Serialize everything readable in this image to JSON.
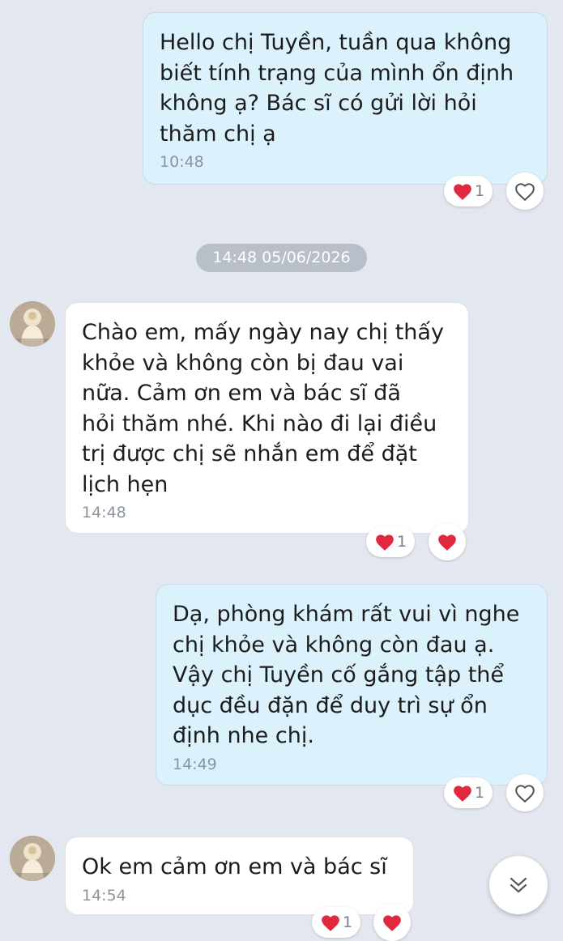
{
  "conversation": {
    "date_separator": "14:48 05/06/2026",
    "messages": [
      {
        "sender": "self",
        "text": "Hello chị Tuyền, tuần qua không\nbiết tính trạng của mình ổn định\nkhông ạ? Bác sĩ có gửi lời hỏi\nthăm chị ạ",
        "time": "10:48",
        "reaction": {
          "icon": "heart",
          "count": "1",
          "liked_by_me": false
        }
      },
      {
        "sender": "contact",
        "text": "Chào em, mấy ngày nay chị thấy\nkhỏe và không còn bị đau vai\nnữa. Cảm ơn em và bác sĩ đã\nhỏi thăm nhé. Khi nào đi lại điều\ntrị được chị sẽ nhắn em để đặt\nlịch hẹn",
        "time": "14:48",
        "reaction": {
          "icon": "heart",
          "count": "1",
          "liked_by_me": true
        }
      },
      {
        "sender": "self",
        "text": "Dạ, phòng khám rất vui vì nghe\nchị khỏe và không còn đau ạ.\nVậy chị Tuyền cố gắng tập thể\ndục đều đặn để duy trì sự ổn\nđịnh nhe chị.",
        "time": "14:49",
        "reaction": {
          "icon": "heart",
          "count": "1",
          "liked_by_me": false
        }
      },
      {
        "sender": "contact",
        "text": "Ok em cảm ơn em và bác sĩ",
        "time": "14:54",
        "reaction": {
          "icon": "heart",
          "count": "1",
          "liked_by_me": true
        }
      }
    ]
  },
  "colors": {
    "background": "#e3e7ef",
    "sent_bubble": "#dbf1fc",
    "received_bubble": "#ffffff",
    "heart": "#e0283e",
    "timestamp": "#8c949e"
  },
  "icons": {
    "reaction": "heart-icon",
    "scroll": "double-chevron-down-icon",
    "avatar": "contact-avatar"
  }
}
